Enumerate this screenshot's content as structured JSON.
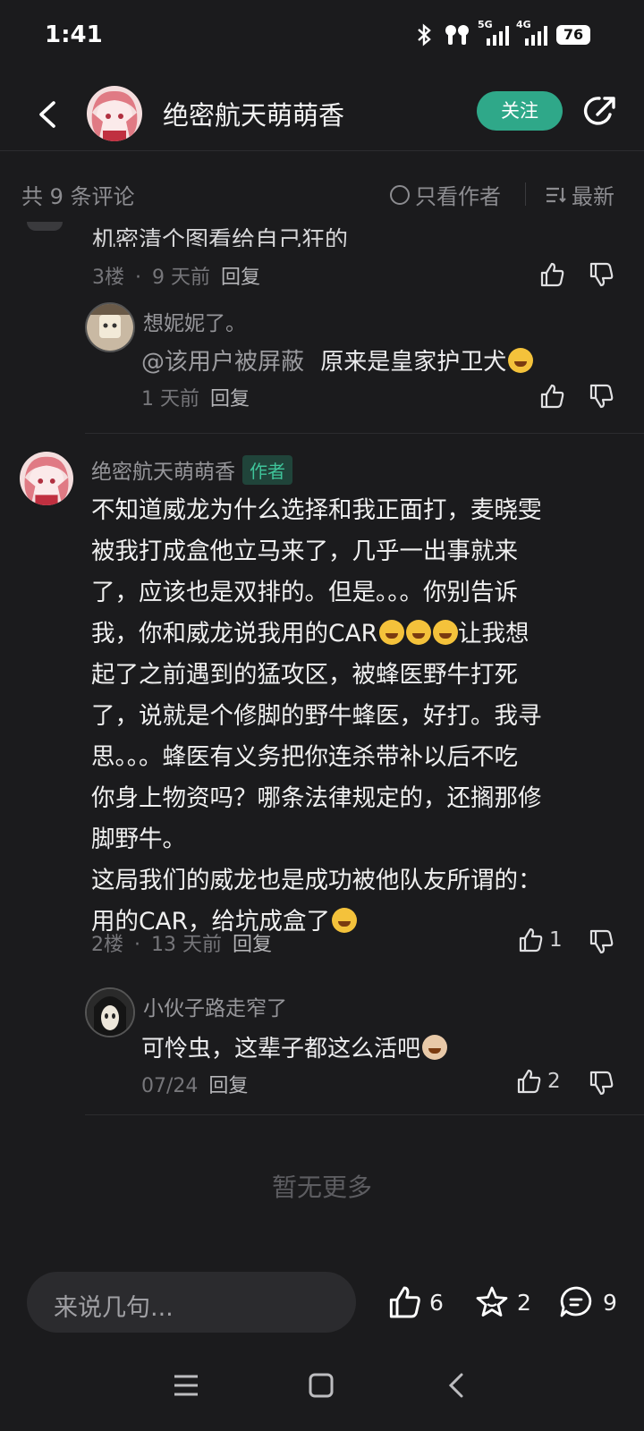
{
  "status": {
    "time": "1:41",
    "net1": "5G",
    "net2": "4G",
    "battery": "76"
  },
  "header": {
    "title": "绝密航天萌萌香",
    "follow_label": "关注"
  },
  "filter": {
    "count_text": "共 9 条评论",
    "author_only": "只看作者",
    "sort_label": "最新"
  },
  "comment3": {
    "clipped_text": "机密清个图看给自己狂的",
    "floor": "3楼",
    "time": "9 天前",
    "reply_label": "回复",
    "reply": {
      "name": "想妮妮了。",
      "mention": "@该用户被屏蔽",
      "text": "原来是皇家护卫犬",
      "time": "1 天前",
      "reply_label": "回复"
    }
  },
  "comment2": {
    "name": "绝密航天萌萌香",
    "tag": "作者",
    "lines": [
      "不知道威龙为什么选择和我正面打，麦晓雯",
      "被我打成盒他立马来了，几乎一出事就来",
      "了，应该也是双排的。但是。。。你别告诉",
      "我，你和威龙说我用的CAR",
      "起了之前遇到的猛攻区，被蜂医野牛打死",
      "了，说就是个修脚的野牛蜂医，好打。我寻",
      "思。。。蜂医有义务把你连杀带补以后不吃",
      "你身上物资吗？哪条法律规定的，还搁那修",
      "脚野牛。"
    ],
    "line4_suffix": "让我想",
    "para2_line1": "这局我们的威龙也是成功被他队友所谓的：",
    "para2_line2": "用的CAR，给坑成盒了",
    "floor": "2楼",
    "time": "13 天前",
    "reply_label": "回复",
    "likes": "1",
    "reply": {
      "name": "小伙子路走窄了",
      "text": "可怜虫，这辈子都这么活吧",
      "time": "07/24",
      "reply_label": "回复",
      "likes": "2"
    }
  },
  "footer": {
    "no_more": "暂无更多",
    "input_placeholder": "来说几句...",
    "likes": "6",
    "favorites": "2",
    "comments": "9"
  }
}
